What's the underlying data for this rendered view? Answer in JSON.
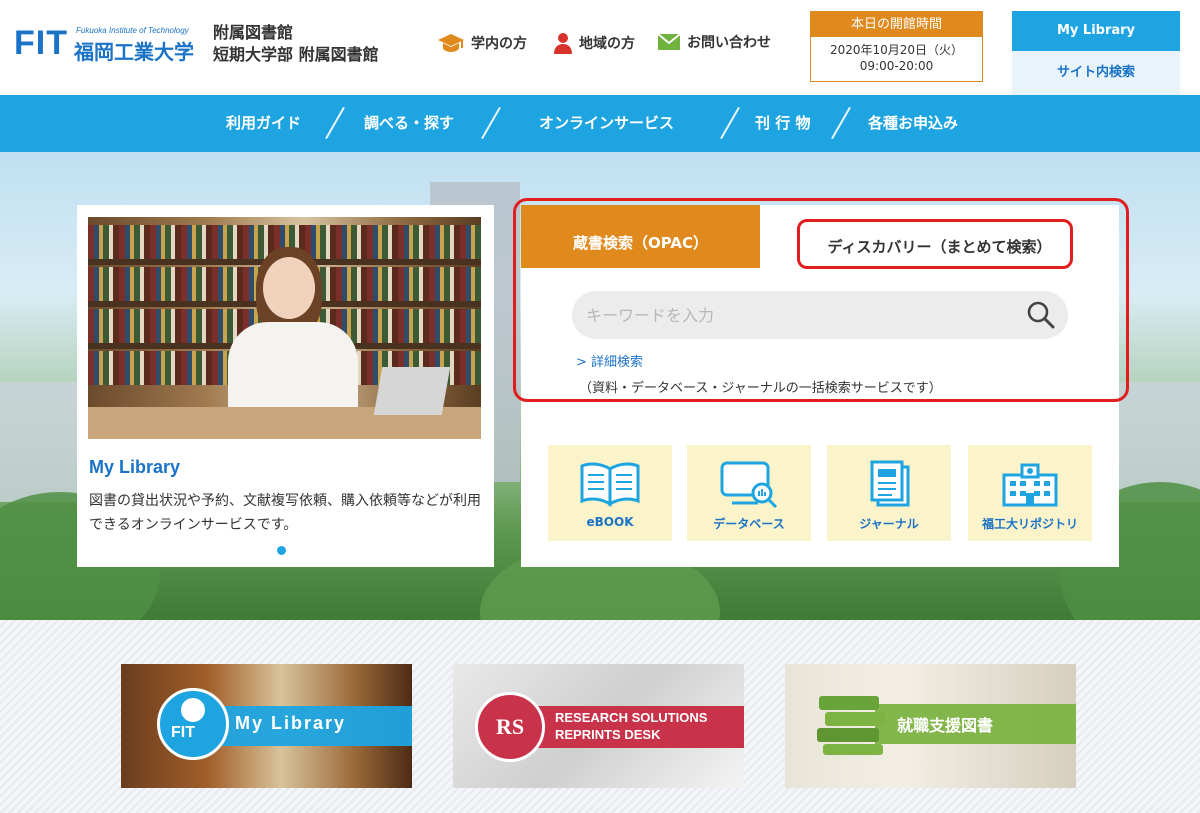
{
  "header": {
    "logo_fit": "FIT",
    "logo_en": "Fukuoka Institute of Technology",
    "logo_jp": "福岡工業大学",
    "library_line1": "附属図書館",
    "library_line2": "短期大学部 附属図書館",
    "quick_links": [
      {
        "label": "学内の方",
        "icon": "graduation-cap-icon"
      },
      {
        "label": "地域の方",
        "icon": "person-icon"
      },
      {
        "label": "お問い合わせ",
        "icon": "mail-icon"
      }
    ],
    "hours_title": "本日の開館時間",
    "hours_date": "2020年10月20日（火）",
    "hours_time": "09:00-20:00",
    "my_library": "My Library",
    "site_search": "サイト内検索"
  },
  "nav": {
    "items": [
      "利用ガイド",
      "調べる・探す",
      "オンラインサービス",
      "刊 行 物",
      "各種お申込み"
    ]
  },
  "card": {
    "title": "My Library",
    "description": "図書の貸出状況や予約、文献複写依頼、購入依頼等などが利用できるオンラインサービスです。"
  },
  "search": {
    "tab_opac": "蔵書検索（OPAC）",
    "tab_discovery": "ディスカバリー（まとめて検索）",
    "placeholder": "キーワードを入力",
    "advanced": "> 詳細検索",
    "note": "（資料・データベース・ジャーナルの一括検索サービスです）"
  },
  "tiles": [
    {
      "label": "eBOOK",
      "icon": "open-book-icon"
    },
    {
      "label": "データベース",
      "icon": "database-monitor-icon"
    },
    {
      "label": "ジャーナル",
      "icon": "journal-icon"
    },
    {
      "label": "福工大リポジトリ",
      "icon": "building-icon"
    }
  ],
  "banners": {
    "mylibrary_logo": "FIT",
    "mylibrary": "My Library",
    "rs_logo": "RS",
    "rs_line1": "RESEARCH SOLUTIONS",
    "rs_line2": "REPRINTS DESK",
    "job": "就職支援図書"
  },
  "colors": {
    "primary": "#1ea4e1",
    "brand": "#1a73c7",
    "accent": "#e08a1e",
    "highlight": "#e01e1e"
  }
}
